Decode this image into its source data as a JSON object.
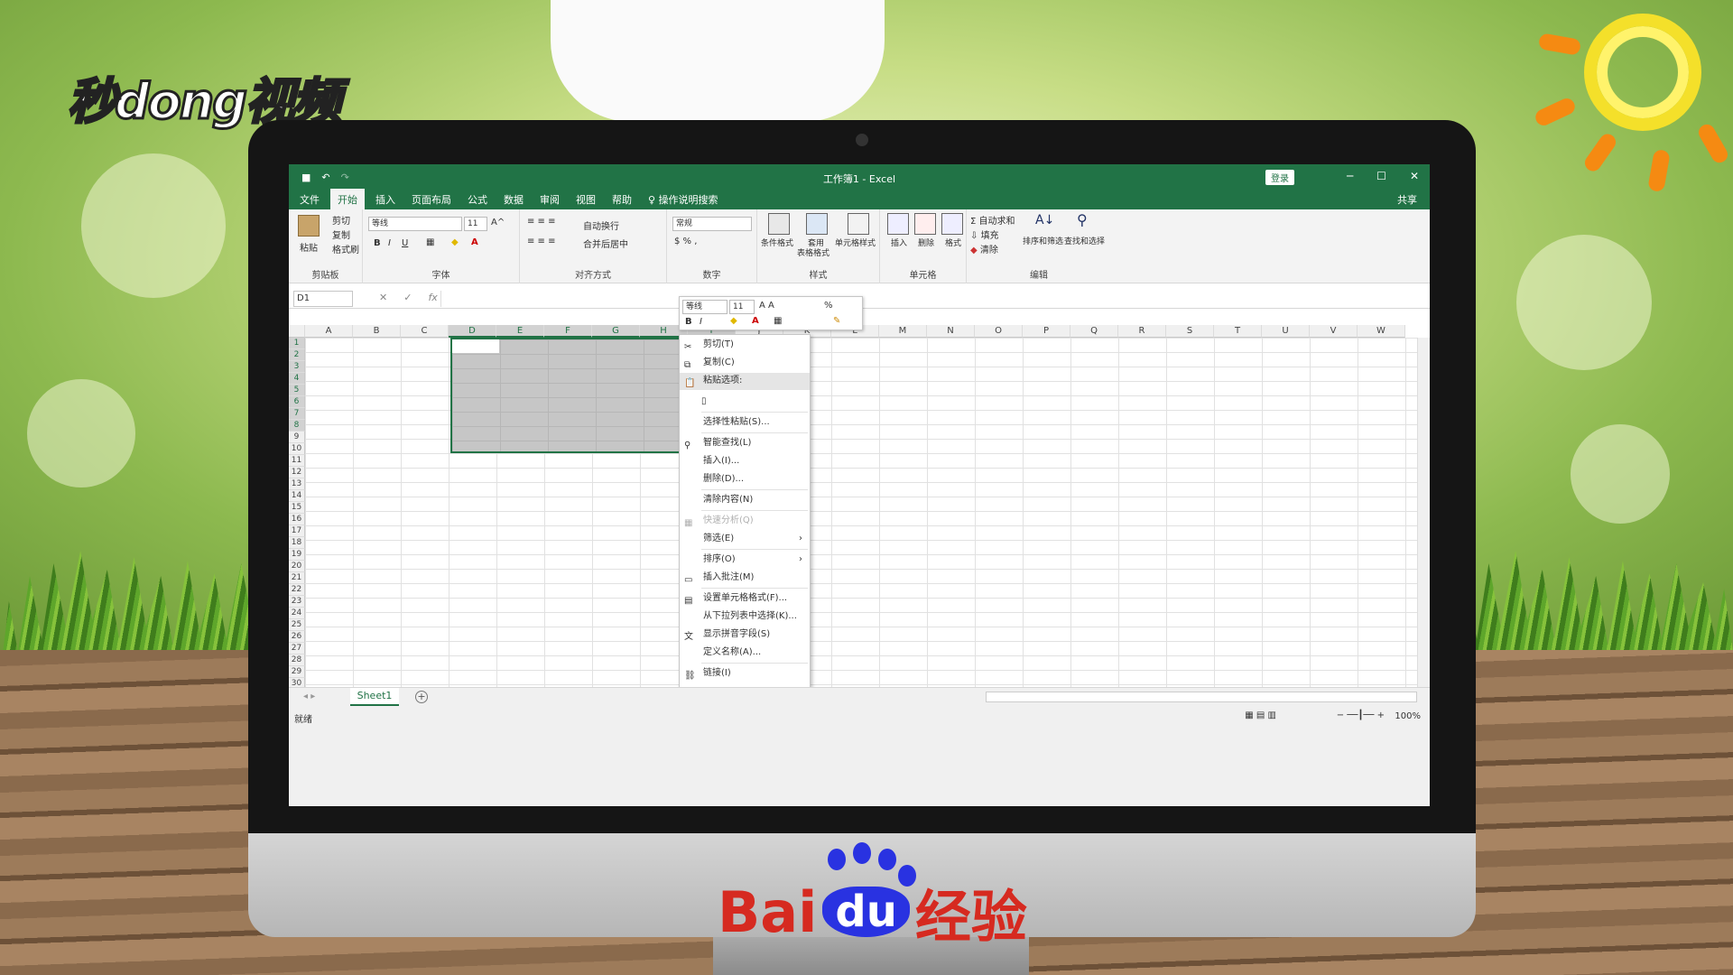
{
  "watermark_top_left": "秒dong视频",
  "brand": {
    "baidu_left": "Bai",
    "baidu_du": "du",
    "baidu_right": "经验"
  },
  "window": {
    "title": "工作簿1 - Excel",
    "login": "登录",
    "minimize": "─",
    "restore": "☐",
    "close": "✕"
  },
  "tabs": {
    "file": "文件",
    "home": "开始",
    "insert": "插入",
    "layout": "页面布局",
    "formulas": "公式",
    "data": "数据",
    "review": "审阅",
    "view": "视图",
    "help": "帮助",
    "search": "操作说明搜索",
    "share": "共享"
  },
  "ribbon": {
    "clipboard": {
      "label": "剪贴板",
      "paste": "粘贴",
      "cut": "剪切",
      "copy": "复制",
      "format_painter": "格式刷"
    },
    "font": {
      "label": "字体",
      "name": "等线",
      "size": "11",
      "bold": "B",
      "italic": "I",
      "underline": "U"
    },
    "alignment": {
      "label": "对齐方式",
      "wrap": "自动换行",
      "merge": "合并后居中"
    },
    "number": {
      "label": "数字",
      "format": "常规"
    },
    "styles": {
      "label": "样式",
      "conditional": "条件格式",
      "table1": "套用",
      "table2": "表格格式",
      "cell_styles": "单元格样式"
    },
    "cells": {
      "label": "单元格",
      "insert": "插入",
      "delete": "删除",
      "format": "格式"
    },
    "editing": {
      "label": "编辑",
      "autosum": "自动求和",
      "fill": "填充",
      "clear": "清除",
      "sort": "排序和筛选",
      "find": "查找和选择"
    }
  },
  "formula_bar": {
    "name_box": "D1",
    "cancel": "✕",
    "enter": "✓",
    "fx": "fx"
  },
  "columns": [
    "A",
    "B",
    "C",
    "D",
    "E",
    "F",
    "G",
    "H",
    "I",
    "J",
    "K",
    "L",
    "M",
    "N",
    "O",
    "P",
    "Q",
    "R",
    "S",
    "T",
    "U",
    "V",
    "W"
  ],
  "selected_columns": [
    "D",
    "E",
    "F",
    "G",
    "H",
    "I"
  ],
  "rows": [
    "1",
    "2",
    "3",
    "4",
    "5",
    "6",
    "7",
    "8",
    "9",
    "10",
    "11",
    "12",
    "13",
    "14",
    "15",
    "16",
    "17",
    "18",
    "19",
    "20",
    "21",
    "22",
    "23",
    "24",
    "25",
    "26",
    "27",
    "28",
    "29",
    "30"
  ],
  "selected_rows": [
    "1",
    "2",
    "3",
    "4",
    "5",
    "6",
    "7",
    "8"
  ],
  "mini_toolbar": {
    "font": "等线",
    "size": "11",
    "bold": "B",
    "italic": "I",
    "percent": "%"
  },
  "context_menu": [
    {
      "label": "剪切(T)",
      "icon": "scissors-icon"
    },
    {
      "label": "复制(C)",
      "icon": "copy-icon"
    },
    {
      "label": "粘贴选项:",
      "icon": "paste-icon"
    },
    {
      "label": "",
      "icon": "paste-option-icon"
    },
    {
      "label": "选择性粘贴(S)...",
      "icon": ""
    },
    {
      "label": "智能查找(L)",
      "icon": "search-icon"
    },
    {
      "label": "插入(I)...",
      "icon": ""
    },
    {
      "label": "删除(D)...",
      "icon": ""
    },
    {
      "label": "清除内容(N)",
      "icon": ""
    },
    {
      "label": "快速分析(Q)",
      "icon": "quick-analysis-icon"
    },
    {
      "label": "筛选(E)",
      "icon": ""
    },
    {
      "label": "排序(O)",
      "icon": ""
    },
    {
      "label": "插入批注(M)",
      "icon": "comment-icon"
    },
    {
      "label": "设置单元格格式(F)...",
      "icon": "format-cells-icon"
    },
    {
      "label": "从下拉列表中选择(K)...",
      "icon": ""
    },
    {
      "label": "显示拼音字段(S)",
      "icon": "phonetic-icon"
    },
    {
      "label": "定义名称(A)...",
      "icon": ""
    },
    {
      "label": "链接(I)",
      "icon": "link-icon"
    }
  ],
  "sheet": {
    "tab": "Sheet1",
    "add": "+"
  },
  "status": {
    "ready": "就绪",
    "zoom": "100%"
  }
}
